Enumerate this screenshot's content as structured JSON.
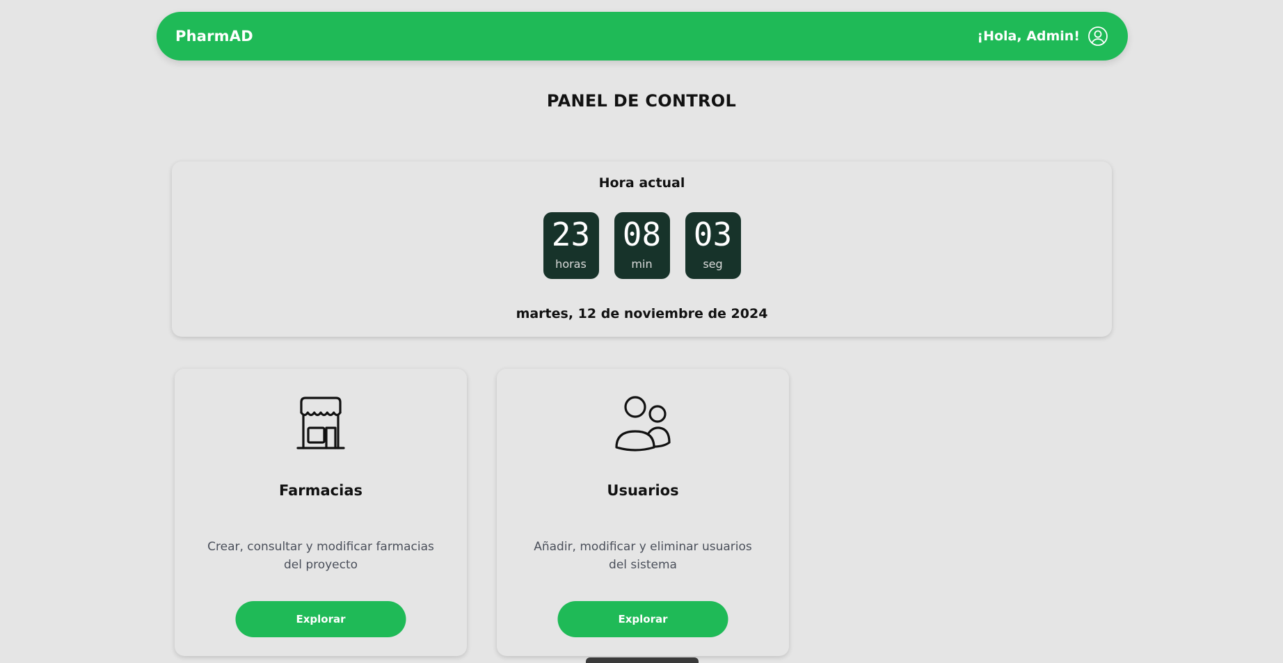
{
  "navbar": {
    "brand": "PharmAD",
    "greeting": "¡Hola, Admin!",
    "user_icon": "user-circle-icon"
  },
  "page": {
    "title": "PANEL DE CONTROL"
  },
  "clock": {
    "title": "Hora actual",
    "hours": "23",
    "hours_label": "horas",
    "minutes": "08",
    "minutes_label": "min",
    "seconds": "03",
    "seconds_label": "seg",
    "date": "martes, 12 de noviembre de 2024"
  },
  "cards": [
    {
      "icon": "store-icon",
      "title": "Farmacias",
      "description": "Crear, consultar y modificar farmacias del proyecto",
      "button": "Explorar"
    },
    {
      "icon": "users-icon",
      "title": "Usuarios",
      "description": "Añadir, modificar y eliminar usuarios del sistema",
      "button": "Explorar"
    }
  ],
  "colors": {
    "accent": "#1fba57",
    "clock_box": "#17332a",
    "background": "#e5e5e5"
  }
}
